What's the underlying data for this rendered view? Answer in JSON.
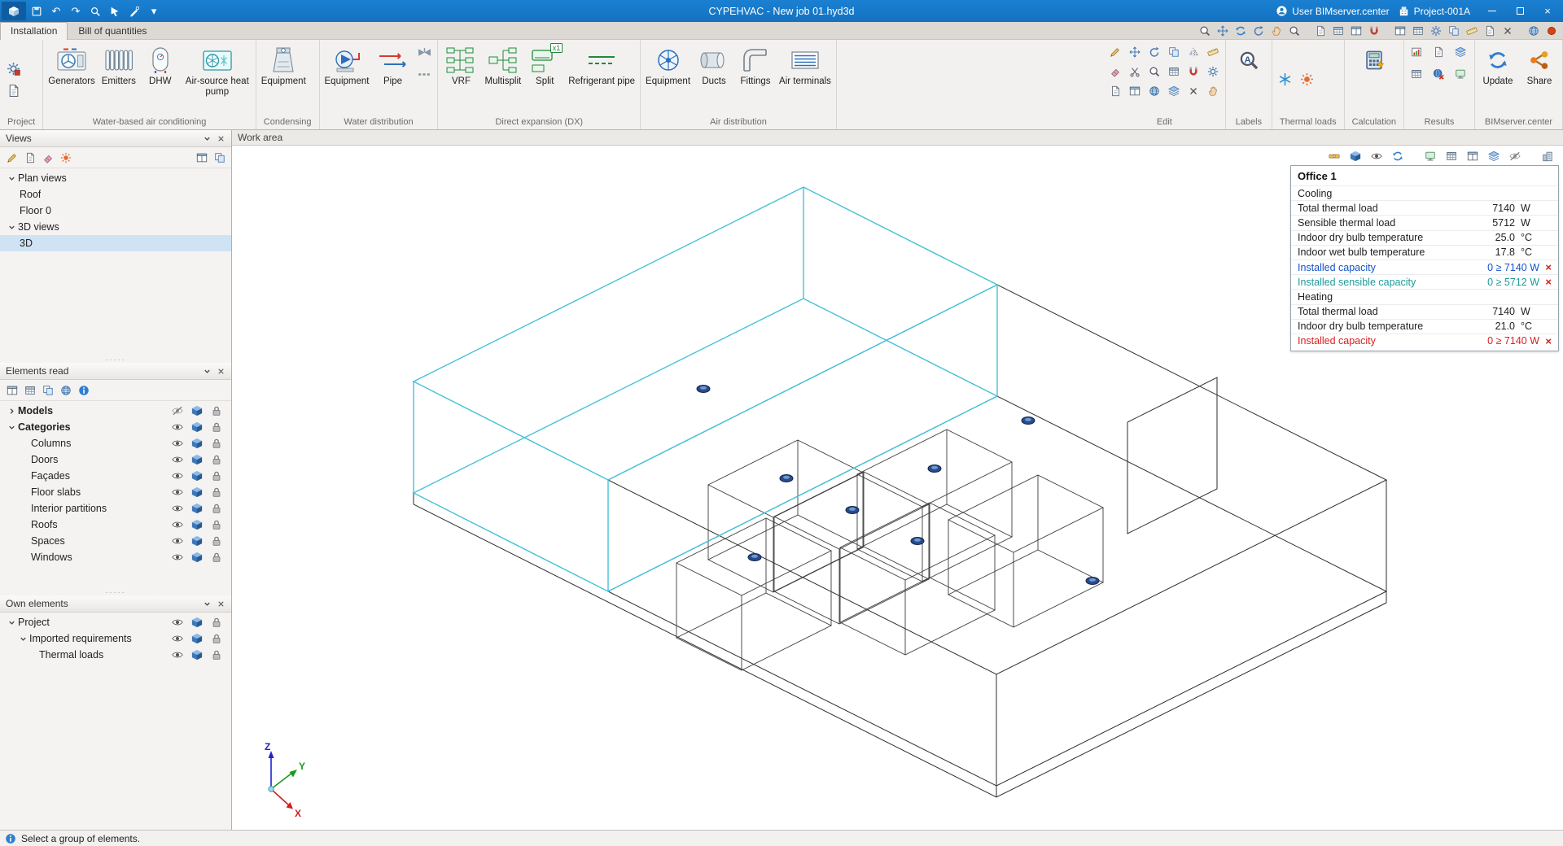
{
  "colors": {
    "titlebar_blue": "#1478c8",
    "selection_blue": "#cfe3f5",
    "model_highlight_cyan": "#45c0d8",
    "link_blue": "#1553c8",
    "link_teal": "#1d9a9a",
    "alert_red": "#e01515",
    "dx_green": "#1f8a3a"
  },
  "icons": {
    "undo": "↶",
    "redo": "↷",
    "caret": "▾",
    "close": "×",
    "fail": "×",
    "dots": "·····",
    "label_a": "A"
  },
  "titlebar": {
    "title": "CYPEHVAC - New job 01.hyd3d",
    "user": "User BIMserver.center",
    "project": "Project-001A"
  },
  "tabs": {
    "installation": "Installation",
    "boq": "Bill of quantities"
  },
  "ribbon": {
    "project": {
      "group": "Project"
    },
    "water": {
      "group": "Water-based air conditioning",
      "generators": "Generators",
      "emitters": "Emitters",
      "dhw": "DHW",
      "heat_pump": "Air-source heat pump"
    },
    "condensing": {
      "group": "Condensing",
      "equipment": "Equipment"
    },
    "water_dist": {
      "group": "Water distribution",
      "equipment": "Equipment",
      "pipe": "Pipe"
    },
    "dx": {
      "group": "Direct expansion (DX)",
      "vrf": "VRF",
      "multisplit": "Multisplit",
      "split": "Split",
      "split_badge": "x1",
      "refrigerant_pipe": "Refrigerant pipe"
    },
    "air": {
      "group": "Air distribution",
      "equipment": "Equipment",
      "ducts": "Ducts",
      "fittings": "Fittings",
      "terminals": "Air terminals"
    },
    "edit": {
      "group": "Edit"
    },
    "labels": {
      "group": "Labels"
    },
    "thermal": {
      "group": "Thermal loads"
    },
    "calculation": {
      "group": "Calculation"
    },
    "results": {
      "group": "Results"
    },
    "bim": {
      "group": "BIMserver.center",
      "update": "Update",
      "share": "Share"
    }
  },
  "views": {
    "title": "Views",
    "plan_views": "Plan views",
    "roof": "Roof",
    "floor0": "Floor 0",
    "views3d": "3D views",
    "view3d": "3D"
  },
  "elements": {
    "title": "Elements read",
    "models": "Models",
    "categories": "Categories",
    "columns": "Columns",
    "doors": "Doors",
    "facades": "Façades",
    "floor_slabs": "Floor slabs",
    "interior_partitions": "Interior partitions",
    "roofs": "Roofs",
    "spaces": "Spaces",
    "windows": "Windows"
  },
  "own": {
    "title": "Own elements",
    "project": "Project",
    "imported": "Imported requirements",
    "thermal": "Thermal loads"
  },
  "workarea": {
    "title": "Work area",
    "status": "Select a group of elements.",
    "axis": {
      "x": "X",
      "y": "Y",
      "z": "Z"
    }
  },
  "info": {
    "title": "Office 1",
    "rows": [
      {
        "label": "Cooling",
        "section": true
      },
      {
        "label": "Total thermal load",
        "value": "7140",
        "unit": "W"
      },
      {
        "label": "Sensible thermal load",
        "value": "5712",
        "unit": "W"
      },
      {
        "label": "Indoor dry bulb temperature",
        "value": "25.0",
        "unit": "°C"
      },
      {
        "label": "Indoor wet bulb temperature",
        "value": "17.8",
        "unit": "°C"
      },
      {
        "label": "Installed capacity",
        "value": "0 ≥ 7140 W",
        "fail": true,
        "color": "blue"
      },
      {
        "label": "Installed sensible capacity",
        "value": "0 ≥ 5712 W",
        "fail": true,
        "color": "teal"
      },
      {
        "label": "Heating",
        "section": true
      },
      {
        "label": "Total thermal load",
        "value": "7140",
        "unit": "W"
      },
      {
        "label": "Indoor dry bulb temperature",
        "value": "21.0",
        "unit": "°C"
      },
      {
        "label": "Installed capacity",
        "value": "0 ≥ 7140 W",
        "fail": true,
        "color": "red"
      }
    ]
  }
}
